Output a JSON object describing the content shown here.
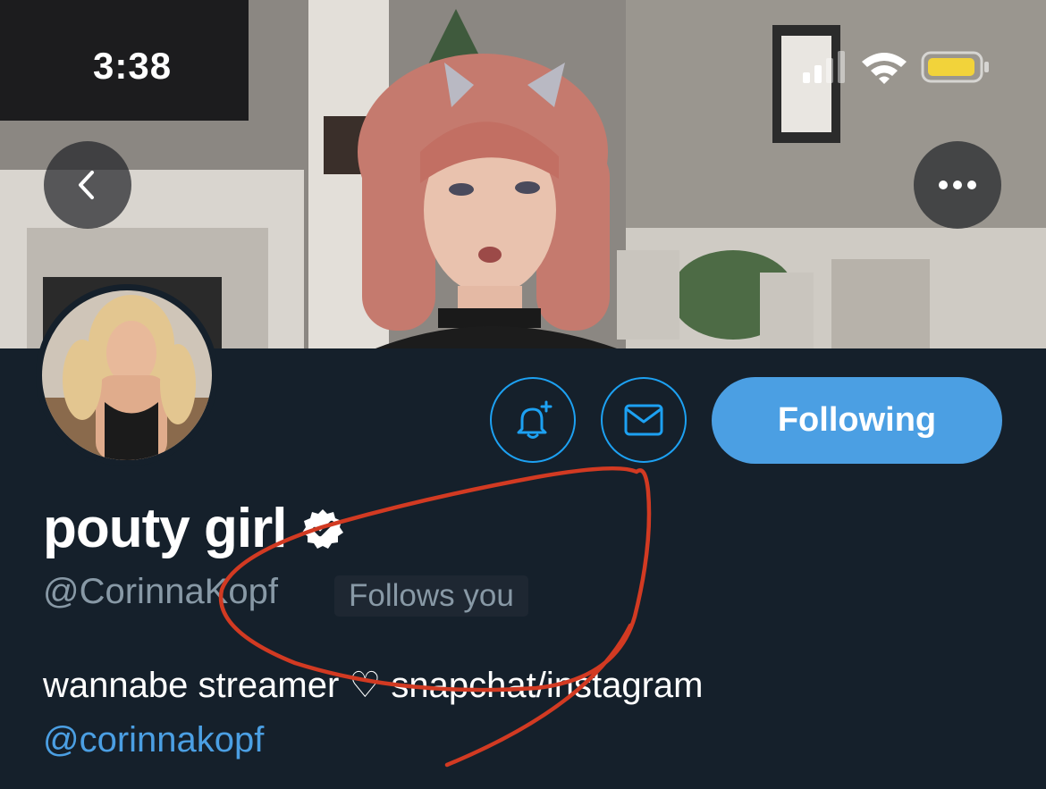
{
  "status_bar": {
    "time": "3:38"
  },
  "profile": {
    "display_name": "pouty girl",
    "handle": "@CorinnaKopf",
    "follows_you_label": "Follows you",
    "bio_text": "wannabe streamer ♡ snapchat/instagram",
    "bio_link": "@corinnakopf"
  },
  "actions": {
    "following_label": "Following"
  },
  "icons": {
    "back": "chevron-left-icon",
    "more": "more-horizontal-icon",
    "notify": "bell-plus-icon",
    "message": "mail-icon",
    "verified": "verified-badge-icon"
  },
  "colors": {
    "background": "#15202b",
    "accent": "#4b9fe3",
    "secondary_text": "#8899a6",
    "annotation_red": "#d23a22"
  }
}
